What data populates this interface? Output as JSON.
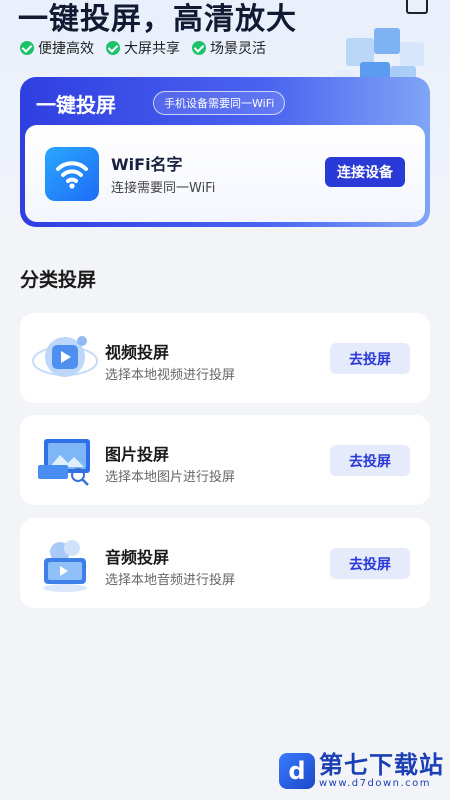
{
  "hero": {
    "title": "一键投屏，高清放大",
    "features": [
      "便捷高效",
      "大屏共享",
      "场景灵活"
    ]
  },
  "main_card": {
    "title": "一键投屏",
    "note": "手机设备需要同一WiFi",
    "wifi_name": "WiFi名字",
    "wifi_sub": "连接需要同一WiFi",
    "connect_label": "连接设备"
  },
  "section_title": "分类投屏",
  "categories": [
    {
      "name": "视频投屏",
      "desc": "选择本地视频进行投屏",
      "button": "去投屏"
    },
    {
      "name": "图片投屏",
      "desc": "选择本地图片进行投屏",
      "button": "去投屏"
    },
    {
      "name": "音频投屏",
      "desc": "选择本地音频进行投屏",
      "button": "去投屏"
    }
  ],
  "watermark": {
    "name": "第七下载站",
    "url": "www.d7down.com",
    "logo_letter": "d"
  },
  "colors": {
    "primary": "#2a3ad6",
    "check_green": "#1ec26b",
    "button_light": "#e6ebfb"
  },
  "icons": {
    "edit": "edit-icon",
    "wifi": "wifi-icon",
    "video": "video-illustration-icon",
    "image": "image-illustration-icon",
    "audio": "audio-illustration-icon"
  }
}
